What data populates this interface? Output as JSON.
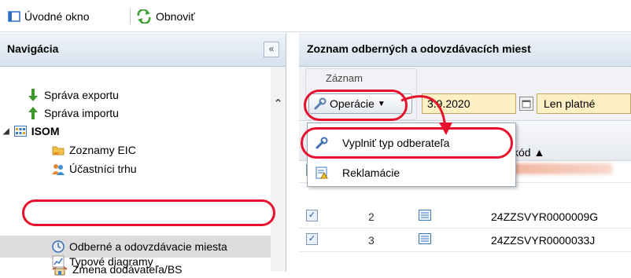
{
  "toolbar": {
    "home_label": "Úvodné okno",
    "refresh_label": "Obnoviť"
  },
  "nav": {
    "title": "Navigácia",
    "collapse_glyph": "«",
    "items": [
      {
        "label": "Správa exportu",
        "icon": "arrow-down-icon"
      },
      {
        "label": "Správa importu",
        "icon": "arrow-up-icon"
      },
      {
        "label": "ISOM",
        "icon": "grid-icon"
      },
      {
        "label": "Zoznamy EIC",
        "icon": "folder-icon"
      },
      {
        "label": "Účastníci trhu",
        "icon": "users-icon"
      },
      {
        "label": "Odberné a odovzdávacie miesta",
        "icon": "clock-icon"
      },
      {
        "label": "Zmena dodávateľa/BS",
        "icon": "house-icon"
      },
      {
        "label": "Typové diagramy",
        "icon": "chart-icon"
      }
    ],
    "scroll_up_glyph": "⌃"
  },
  "main": {
    "title": "Zoznam odberných a odovzdávacích miest",
    "ribbon_group": "Záznam",
    "operations_label": "Operácie",
    "date_value": "3.9.2020",
    "filter_value": "Len platné",
    "column_kod": "kód ▲",
    "rows": [
      {
        "num": "2",
        "code": "24ZZSVYR0000009G",
        "checked": "✓"
      },
      {
        "num": "3",
        "code": "24ZZSVYR0000033J",
        "checked": "✓"
      }
    ]
  },
  "menu": {
    "items": [
      {
        "label": "Vyplniť typ odberateľa",
        "icon": "wrench-icon"
      },
      {
        "label": "Reklamácie",
        "icon": "report-icon"
      }
    ]
  },
  "colors": {
    "annotation_red": "#e8112d",
    "highlight_field": "#fdf0c4",
    "panel_header": "#d7e2ee"
  }
}
